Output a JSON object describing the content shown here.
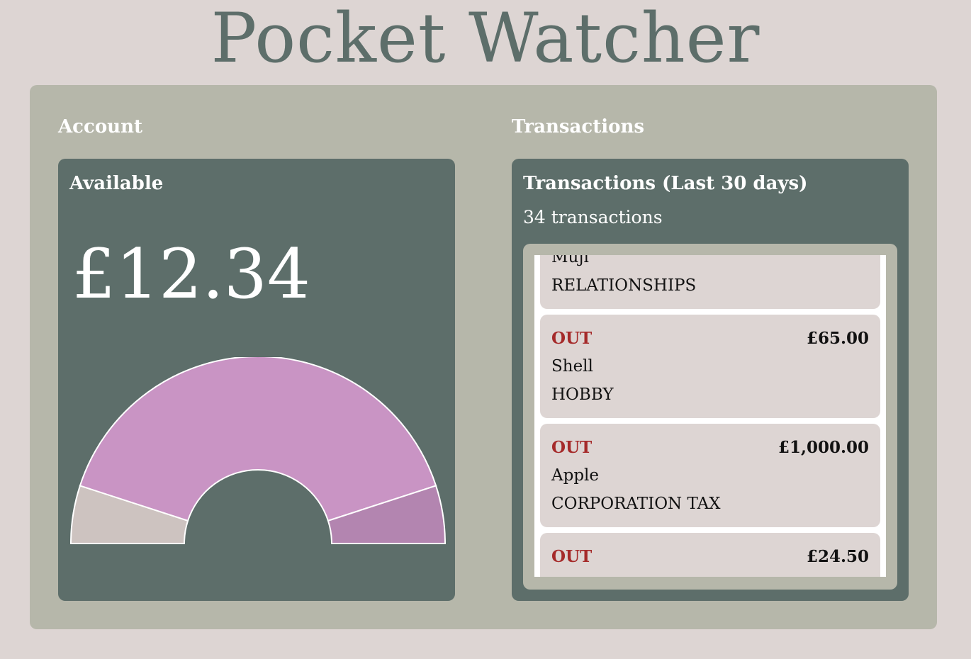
{
  "app": {
    "title": "Pocket Watcher"
  },
  "account": {
    "heading": "Account",
    "card_title": "Available",
    "balance": "£12.34",
    "gauge": {
      "segment_fractions": [
        0.1,
        0.8,
        0.1
      ],
      "colors": [
        "#cdc3c0",
        "#c994c4",
        "#b385b0"
      ]
    }
  },
  "transactions": {
    "heading": "Transactions",
    "card_title": "Transactions (Last 30 days)",
    "count_label": "34 transactions",
    "items": [
      {
        "direction": "",
        "amount": "",
        "merchant": "Muji",
        "category": "RELATIONSHIPS"
      },
      {
        "direction": "OUT",
        "amount": "£65.00",
        "merchant": "Shell",
        "category": "HOBBY"
      },
      {
        "direction": "OUT",
        "amount": "£1,000.00",
        "merchant": "Apple",
        "category": "CORPORATION TAX"
      },
      {
        "direction": "OUT",
        "amount": "£24.50",
        "merchant": "",
        "category": ""
      }
    ]
  },
  "colors": {
    "page_bg": "#ddd5d3",
    "panel_bg": "#b6b7aa",
    "card_bg": "#5d6e6a",
    "out_color": "#a52a2a"
  }
}
